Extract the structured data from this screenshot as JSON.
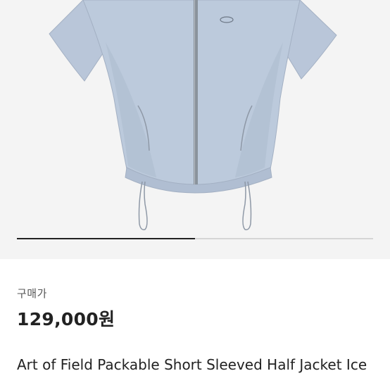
{
  "product": {
    "image_alt": "Light blue short sleeved half jacket",
    "image_index": 1,
    "image_count": 2,
    "price_label": "구매가",
    "price": "129,000원",
    "title": "Art of Field Packable Short Sleeved Half Jacket Ice"
  },
  "colors": {
    "jacket": "#b9c6d9",
    "jacket_shade": "#a7b5ca",
    "zipper": "#8a939c",
    "background": "#f4f4f4"
  }
}
